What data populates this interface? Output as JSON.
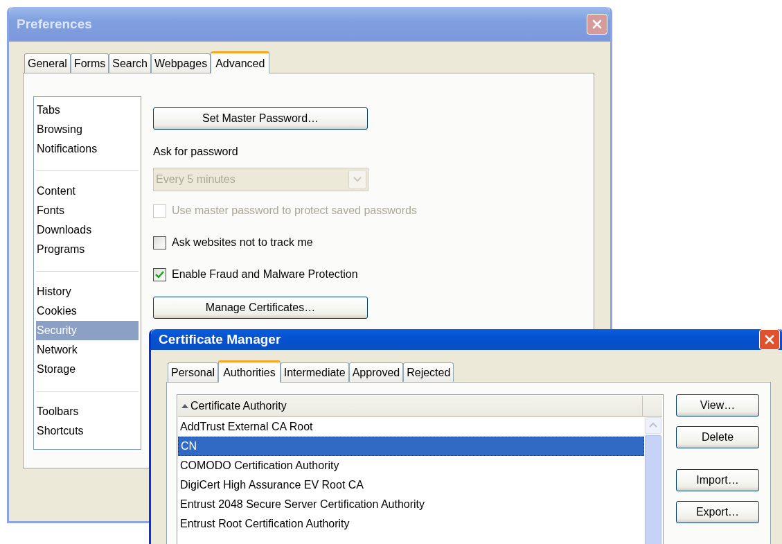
{
  "preferences": {
    "title": "Preferences",
    "active": false,
    "tabs": [
      {
        "label": "General",
        "selected": false
      },
      {
        "label": "Forms",
        "selected": false
      },
      {
        "label": "Search",
        "selected": false
      },
      {
        "label": "Webpages",
        "selected": false
      },
      {
        "label": "Advanced",
        "selected": true
      }
    ],
    "sidebar": [
      {
        "items": [
          {
            "label": "Tabs",
            "selected": false
          },
          {
            "label": "Browsing",
            "selected": false
          },
          {
            "label": "Notifications",
            "selected": false
          }
        ]
      },
      {
        "items": [
          {
            "label": "Content",
            "selected": false
          },
          {
            "label": "Fonts",
            "selected": false
          },
          {
            "label": "Downloads",
            "selected": false
          },
          {
            "label": "Programs",
            "selected": false
          }
        ]
      },
      {
        "items": [
          {
            "label": "History",
            "selected": false
          },
          {
            "label": "Cookies",
            "selected": false
          },
          {
            "label": "Security",
            "selected": true
          },
          {
            "label": "Network",
            "selected": false
          },
          {
            "label": "Storage",
            "selected": false
          }
        ]
      },
      {
        "items": [
          {
            "label": "Toolbars",
            "selected": false
          },
          {
            "label": "Shortcuts",
            "selected": false
          }
        ]
      }
    ],
    "master_password_button": "Set Master Password…",
    "ask_label": "Ask for password",
    "dropdown": {
      "value": "Every 5 minutes",
      "disabled": true
    },
    "checkboxes": [
      {
        "label": "Use master password to protect saved passwords",
        "checked": false,
        "disabled": true
      },
      {
        "label": "Ask websites not to track me",
        "checked": false,
        "disabled": false
      },
      {
        "label": "Enable Fraud and Malware Protection",
        "checked": true,
        "disabled": false
      }
    ],
    "manage_button": "Manage Certificates…"
  },
  "certificate_manager": {
    "title": "Certificate Manager",
    "active": true,
    "tabs": [
      {
        "label": "Personal",
        "selected": false
      },
      {
        "label": "Authorities",
        "selected": true
      },
      {
        "label": "Intermediate",
        "selected": false
      },
      {
        "label": "Approved",
        "selected": false
      },
      {
        "label": "Rejected",
        "selected": false
      }
    ],
    "column": {
      "label": "Certificate Authority",
      "sort_ascending": true
    },
    "rows": [
      {
        "label": "AddTrust External CA Root",
        "selected": false
      },
      {
        "label": "CN",
        "selected": true
      },
      {
        "label": "COMODO Certification Authority",
        "selected": false
      },
      {
        "label": "DigiCert High Assurance EV Root CA",
        "selected": false
      },
      {
        "label": "Entrust 2048 Secure Server Certification Authority",
        "selected": false
      },
      {
        "label": "Entrust Root Certification Authority",
        "selected": false
      }
    ],
    "buttons": [
      {
        "label": "View…"
      },
      {
        "label": "Delete"
      },
      {
        "label": "Import…"
      },
      {
        "label": "Export…"
      }
    ]
  }
}
